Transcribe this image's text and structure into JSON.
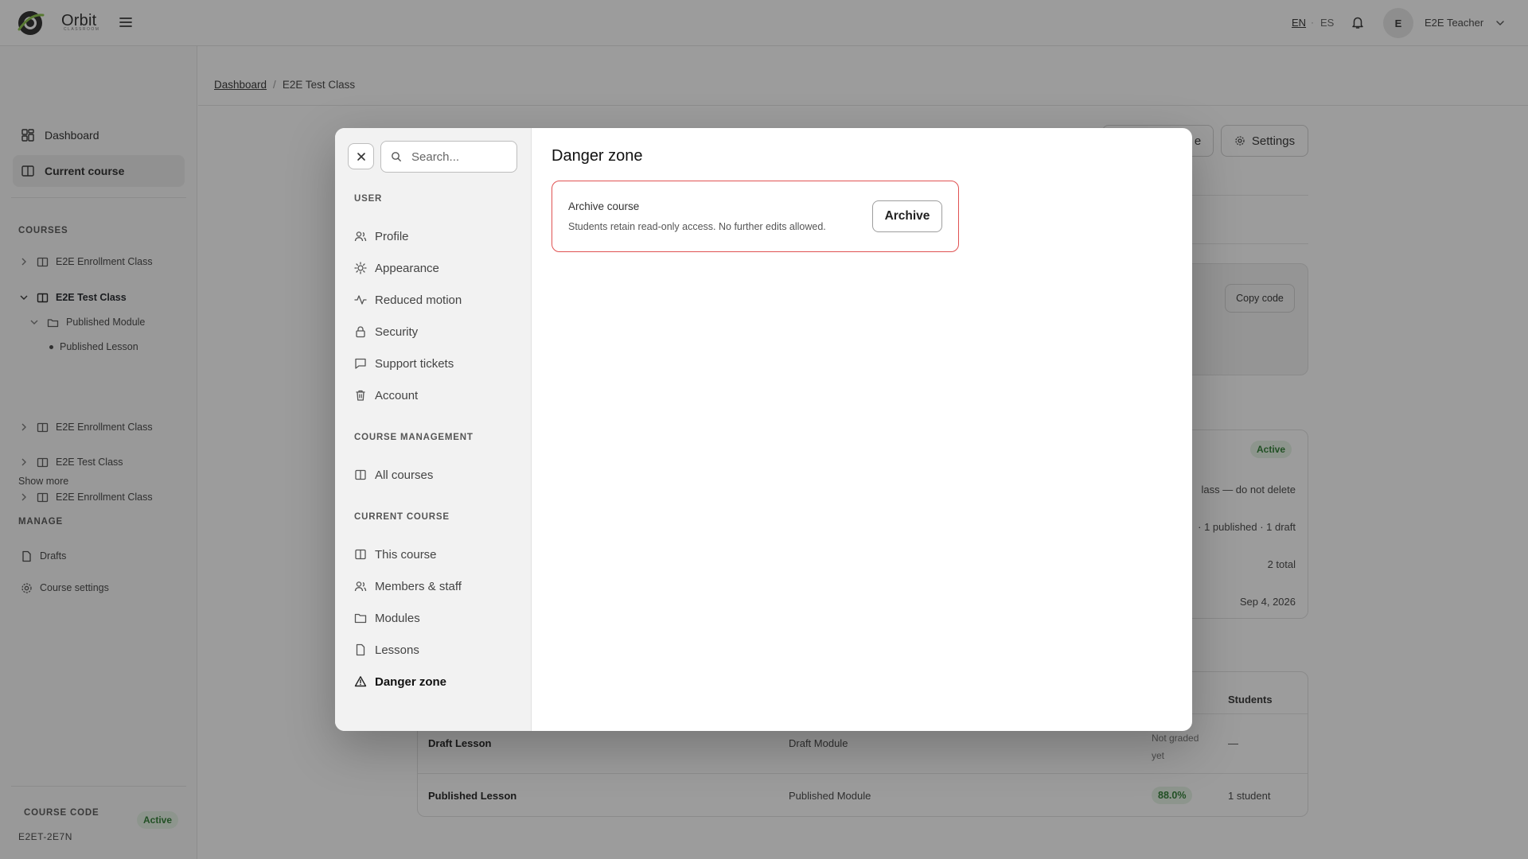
{
  "header": {
    "brand": "Orbit",
    "brand_sub": "CLASSROOM",
    "lang_en": "EN",
    "lang_sep": "·",
    "lang_es": "ES",
    "avatar_initial": "E",
    "user_name": "E2E Teacher"
  },
  "sidebar": {
    "dashboard": "Dashboard",
    "current_course": "Current course",
    "courses_label": "COURSES",
    "courses": [
      {
        "label": "E2E Enrollment Class"
      },
      {
        "label": "E2E Test Class"
      },
      {
        "label": "Published Module"
      },
      {
        "label": "Published Lesson"
      },
      {
        "label": "E2E Enrollment Class"
      },
      {
        "label": "E2E Test Class"
      },
      {
        "label": "E2E Enrollment Class"
      }
    ],
    "show_more": "Show more",
    "manage_label": "MANAGE",
    "drafts": "Drafts",
    "course_settings": "Course settings",
    "course_code_label": "COURSE CODE",
    "course_code": "E2ET-2E7N",
    "status": "Active"
  },
  "main": {
    "breadcrumb": {
      "root": "Dashboard",
      "sep": "/",
      "current": "E2E Test Class"
    },
    "btn_partial": "e",
    "settings_btn": "Settings",
    "copy_code": "Copy code",
    "details": {
      "status": "Active",
      "description": "lass — do not delete",
      "lessons": "· 1 published · 1 draft",
      "members": "2 total",
      "date": "Sep 4, 2026"
    },
    "table": {
      "col_grade_partial": "de",
      "col_students": "Students",
      "rows": [
        {
          "lesson": "Draft Lesson",
          "module": "Draft Module",
          "grade": "Not graded yet",
          "students": "—"
        },
        {
          "lesson": "Published Lesson",
          "module": "Published Module",
          "grade": "88.0%",
          "students": "1 student"
        }
      ]
    }
  },
  "modal": {
    "search_placeholder": "Search...",
    "sections": {
      "user": "USER",
      "course_management": "COURSE MANAGEMENT",
      "current_course": "CURRENT COURSE"
    },
    "items": {
      "profile": "Profile",
      "appearance": "Appearance",
      "reduced_motion": "Reduced motion",
      "security": "Security",
      "support_tickets": "Support tickets",
      "account": "Account",
      "all_courses": "All courses",
      "this_course": "This course",
      "members_staff": "Members & staff",
      "modules": "Modules",
      "lessons": "Lessons",
      "danger_zone": "Danger zone"
    },
    "title": "Danger zone",
    "archive_card": {
      "title": "Archive course",
      "description": "Students retain read-only access. No further edits allowed.",
      "button": "Archive"
    }
  },
  "colors": {
    "danger_border": "#e05252",
    "active_green": "#2e7d32",
    "overlay": "rgba(20,20,20,0.42)"
  }
}
